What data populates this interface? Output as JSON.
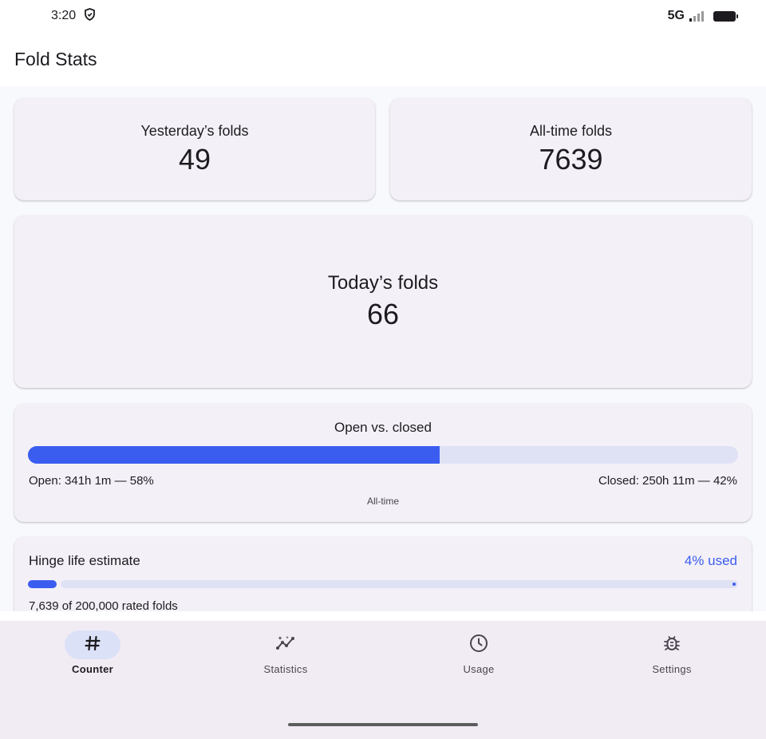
{
  "status_bar": {
    "time": "3:20",
    "network": "5G",
    "icons": [
      "shield-icon",
      "signal-icon",
      "battery-icon"
    ]
  },
  "app_bar": {
    "title": "Fold Stats"
  },
  "cards": {
    "yesterday": {
      "label": "Yesterday’s folds",
      "value": "49"
    },
    "all_time": {
      "label": "All-time folds",
      "value": "7639"
    },
    "today": {
      "label": "Today’s folds",
      "value": "66"
    }
  },
  "open_vs_closed": {
    "title": "Open vs. closed",
    "open_text": "Open: 341h 1m — 58%",
    "closed_text": "Closed: 250h 11m — 42%",
    "open_fraction": 0.58,
    "caption": "All-time"
  },
  "hinge": {
    "title": "Hinge life estimate",
    "used_text": "4% used",
    "used_fraction": 0.04,
    "rated_text": "7,639 of 200,000 rated folds"
  },
  "nav": {
    "items": [
      {
        "label": "Counter",
        "icon": "hash-icon",
        "active": true
      },
      {
        "label": "Statistics",
        "icon": "insights-icon",
        "active": false
      },
      {
        "label": "Usage",
        "icon": "clock-icon",
        "active": false
      },
      {
        "label": "Settings",
        "icon": "bug-icon",
        "active": false
      }
    ]
  },
  "colors": {
    "accent": "#3a5df0",
    "track": "#dfe1f5",
    "card": "#f4f0f7",
    "nav_background": "#f1ecf4",
    "nav_active_pill": "#dbe1f7"
  }
}
